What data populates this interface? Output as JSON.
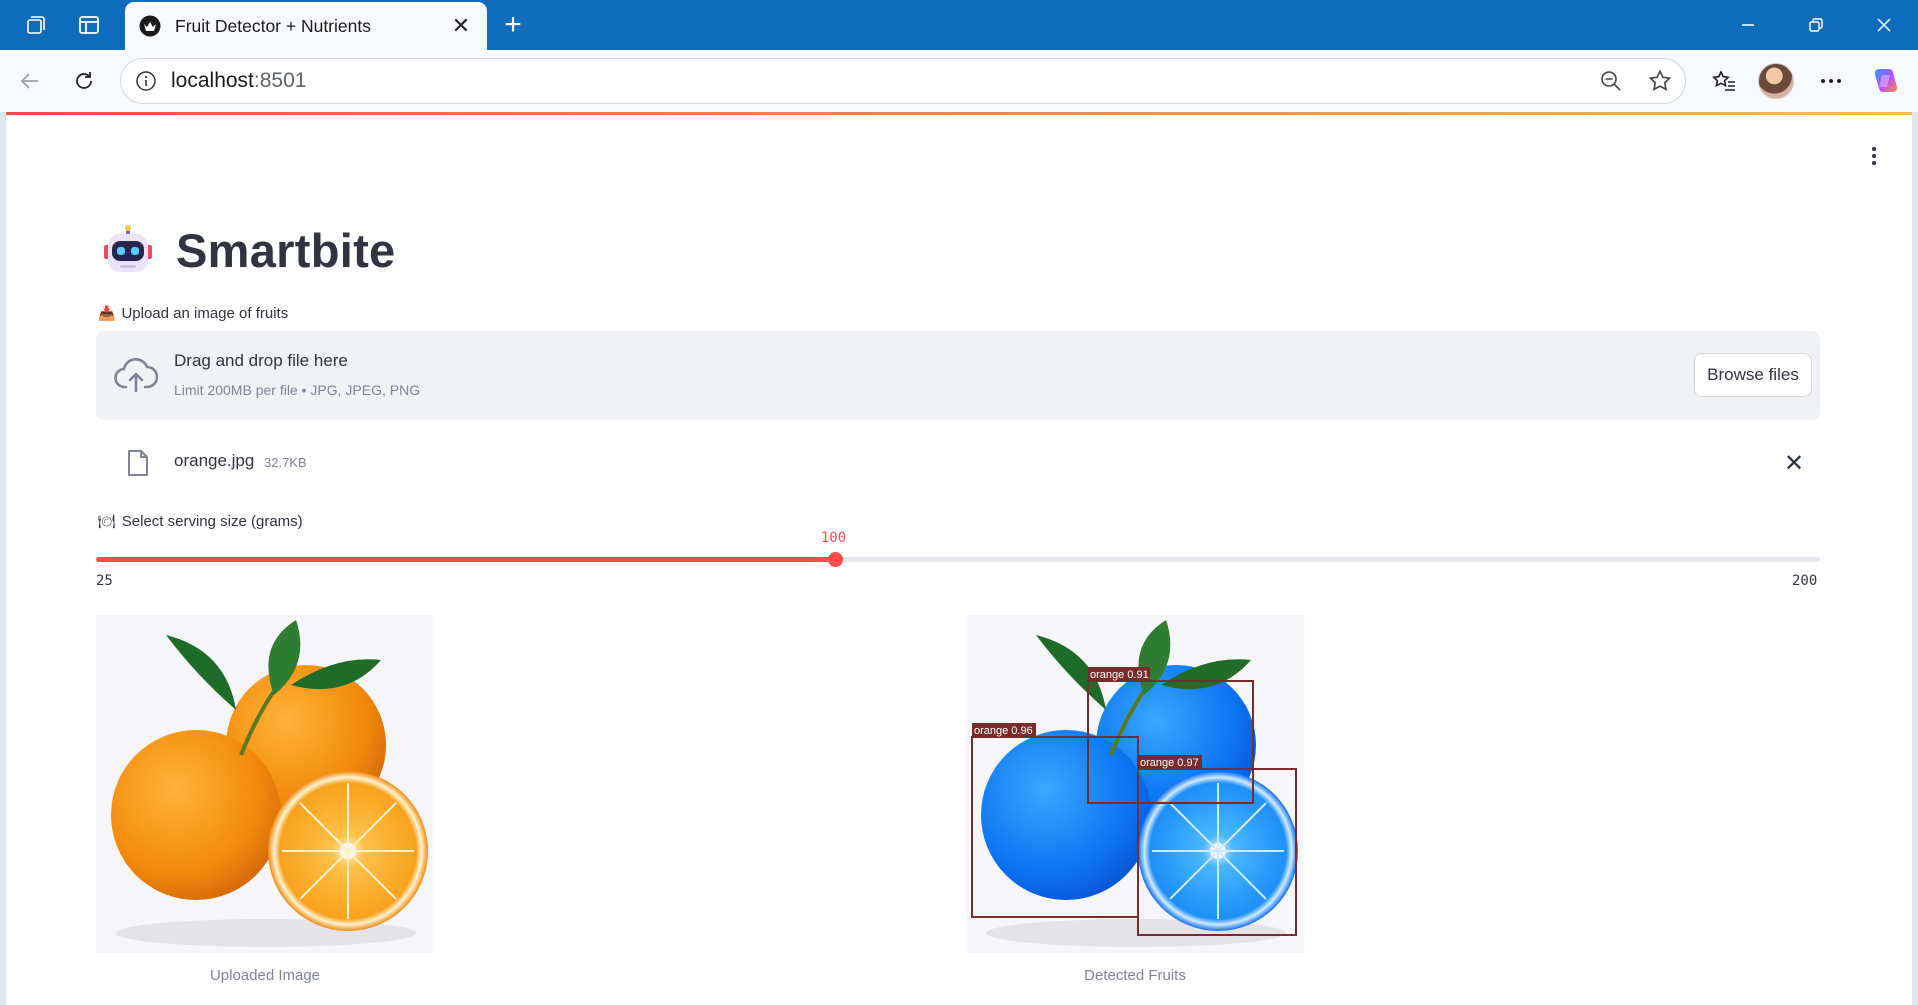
{
  "browser": {
    "tab_title": "Fruit Detector + Nutrients",
    "tab_close": "✕",
    "url_host": "localhost",
    "url_port": ":8501"
  },
  "app": {
    "title": "Smartbite",
    "title_icon": "robot-emoji"
  },
  "uploader": {
    "label_icon": "📥",
    "label": "Upload an image of fruits",
    "drop_title": "Drag and drop file here",
    "drop_sub": "Limit 200MB per file • JPG, JPEG, PNG",
    "browse_label": "Browse files",
    "file": {
      "name": "orange.jpg",
      "size": "32.7KB"
    }
  },
  "slider": {
    "label_icon": "🍽",
    "label": "Select serving size (grams)",
    "min": 25,
    "max": 200,
    "value": 100,
    "value_text": "100",
    "min_text": "25",
    "max_text": "200",
    "accent": "#ff4b4b"
  },
  "images": {
    "uploaded_caption": "Uploaded Image",
    "detected_caption": "Detected Fruits",
    "detections": [
      {
        "label": "orange 0.91"
      },
      {
        "label": "orange 0.96"
      },
      {
        "label": "orange 0.97"
      }
    ]
  }
}
